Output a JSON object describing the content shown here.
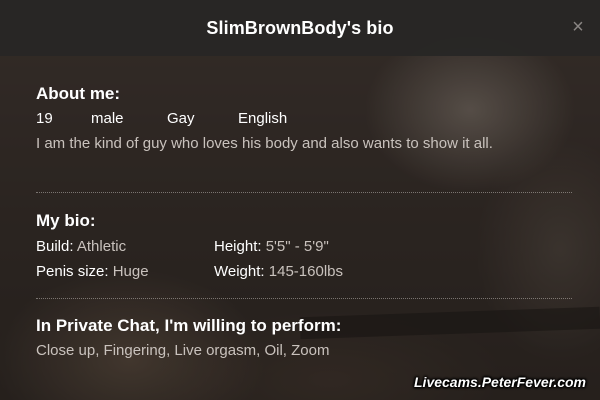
{
  "dialog": {
    "title": "SlimBrownBody's bio",
    "close_glyph": "×"
  },
  "about": {
    "heading": "About me:",
    "age": "19",
    "gender": "male",
    "orientation": "Gay",
    "language": "English",
    "description": "I am the kind of guy who loves his body and also wants to show it all."
  },
  "bio": {
    "heading": "My bio:",
    "build_label": "Build",
    "build_value": "Athletic",
    "height_label": "Height",
    "height_value": "5'5\" - 5'9\"",
    "penis_label": "Penis size",
    "penis_value": "Huge",
    "weight_label": "Weight",
    "weight_value": "145-160lbs"
  },
  "private_chat": {
    "heading": "In Private Chat, I'm willing to perform:",
    "list": "Close up, Fingering, Live orgasm, Oil, Zoom"
  },
  "watermark": "Livecams.PeterFever.com",
  "colors": {
    "titlebar_bg": "#282625",
    "heading_text": "#ffffff",
    "value_text": "#c9c2bd",
    "close_icon": "#8a8684"
  }
}
